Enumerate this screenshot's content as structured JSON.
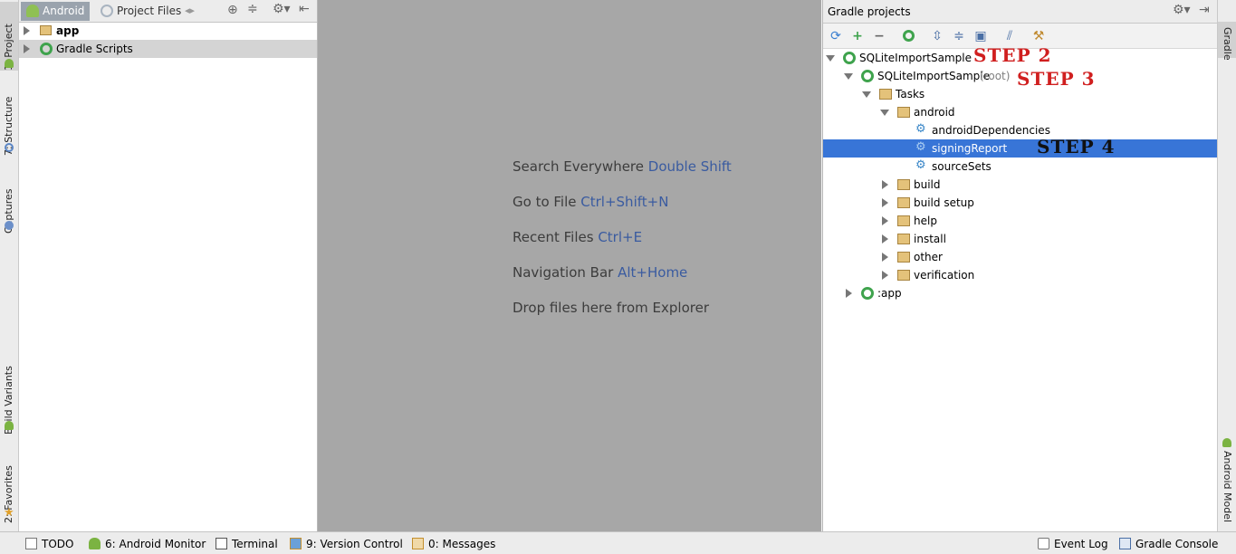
{
  "left_strip": {
    "tabs": [
      "1: Project",
      "7: Structure",
      "Captures",
      "Build Variants",
      "2: Favorites"
    ]
  },
  "project_panel": {
    "tabs": [
      "Android",
      "Project Files"
    ],
    "tree": [
      {
        "label": "app",
        "bold": true
      },
      {
        "label": "Gradle Scripts",
        "bold": false
      }
    ]
  },
  "editor": {
    "hints": [
      {
        "text": "Search Everywhere",
        "key": "Double Shift"
      },
      {
        "text": "Go to File",
        "key": "Ctrl+Shift+N"
      },
      {
        "text": "Recent Files",
        "key": "Ctrl+E"
      },
      {
        "text": "Navigation Bar",
        "key": "Alt+Home"
      },
      {
        "text": "Drop files here from Explorer",
        "key": ""
      }
    ]
  },
  "gradle_panel": {
    "title": "Gradle projects",
    "tree": [
      {
        "label": "SQLiteImportSample",
        "suffix": ""
      },
      {
        "label": "SQLiteImportSample",
        "suffix": "(root)"
      },
      {
        "label": "Tasks"
      },
      {
        "label": "android"
      },
      {
        "label": "androidDependencies"
      },
      {
        "label": "signingReport"
      },
      {
        "label": "sourceSets"
      },
      {
        "label": "build"
      },
      {
        "label": "build setup"
      },
      {
        "label": "help"
      },
      {
        "label": "install"
      },
      {
        "label": "other"
      },
      {
        "label": "verification"
      },
      {
        "label": ":app"
      }
    ],
    "steps": [
      "STEP 2",
      "STEP 3",
      "STEP 4"
    ]
  },
  "right_strip": {
    "tabs": [
      "Gradle",
      "Android Model"
    ]
  },
  "bottom_bar": {
    "items": [
      "TODO",
      "6: Android Monitor",
      "Terminal",
      "9: Version Control",
      "0: Messages"
    ],
    "right_items": [
      "Event Log",
      "Gradle Console"
    ]
  },
  "colors": {
    "selection": "#3875d7",
    "step2": "#d01f1f",
    "step3": "#d01f1f",
    "step4": "#111111",
    "gradle_green": "#3fa34d",
    "folder": "#c9a25a"
  }
}
